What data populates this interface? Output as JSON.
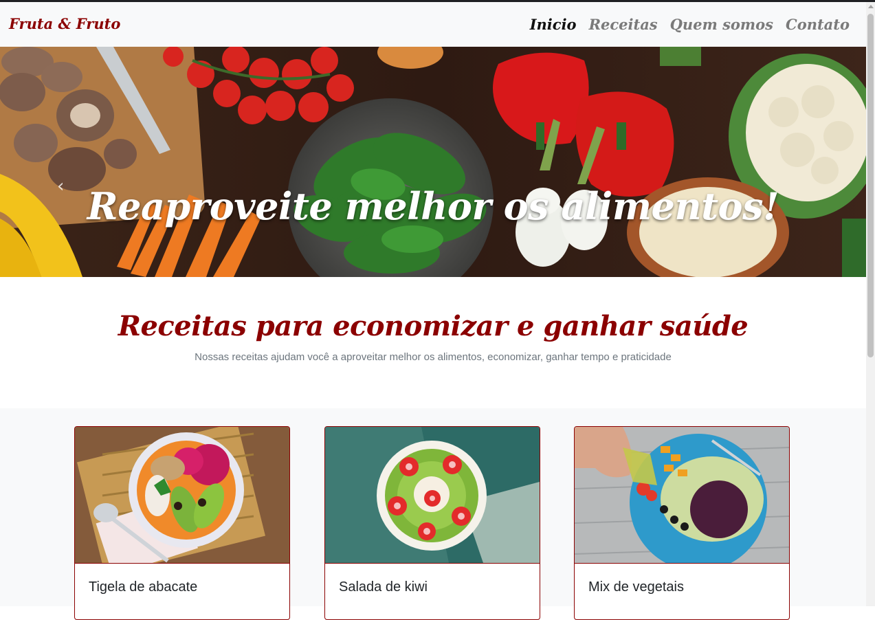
{
  "navbar": {
    "brand": "Fruta & Fruto",
    "links": [
      {
        "label": "Inicio",
        "active": true
      },
      {
        "label": "Receitas",
        "active": false
      },
      {
        "label": "Quem somos",
        "active": false
      },
      {
        "label": "Contato",
        "active": false
      }
    ]
  },
  "hero": {
    "title": "Reaproveite melhor os alimentos!",
    "prev_icon": "chevron-left-icon",
    "slides_count": 3,
    "active_slide": 1
  },
  "intro": {
    "heading": "Receitas para economizar e ganhar saúde",
    "subtitle": "Nossas receitas ajudam você a aproveitar melhor os alimentos, economizar, ganhar tempo e praticidade"
  },
  "cards": [
    {
      "title": "Tigela de abacate"
    },
    {
      "title": "Salada de kiwi"
    },
    {
      "title": "Mix de vegetais"
    }
  ],
  "colors": {
    "brand": "#8b0000",
    "navbar_bg": "#f8f9fa",
    "muted_text": "#6c757d"
  }
}
